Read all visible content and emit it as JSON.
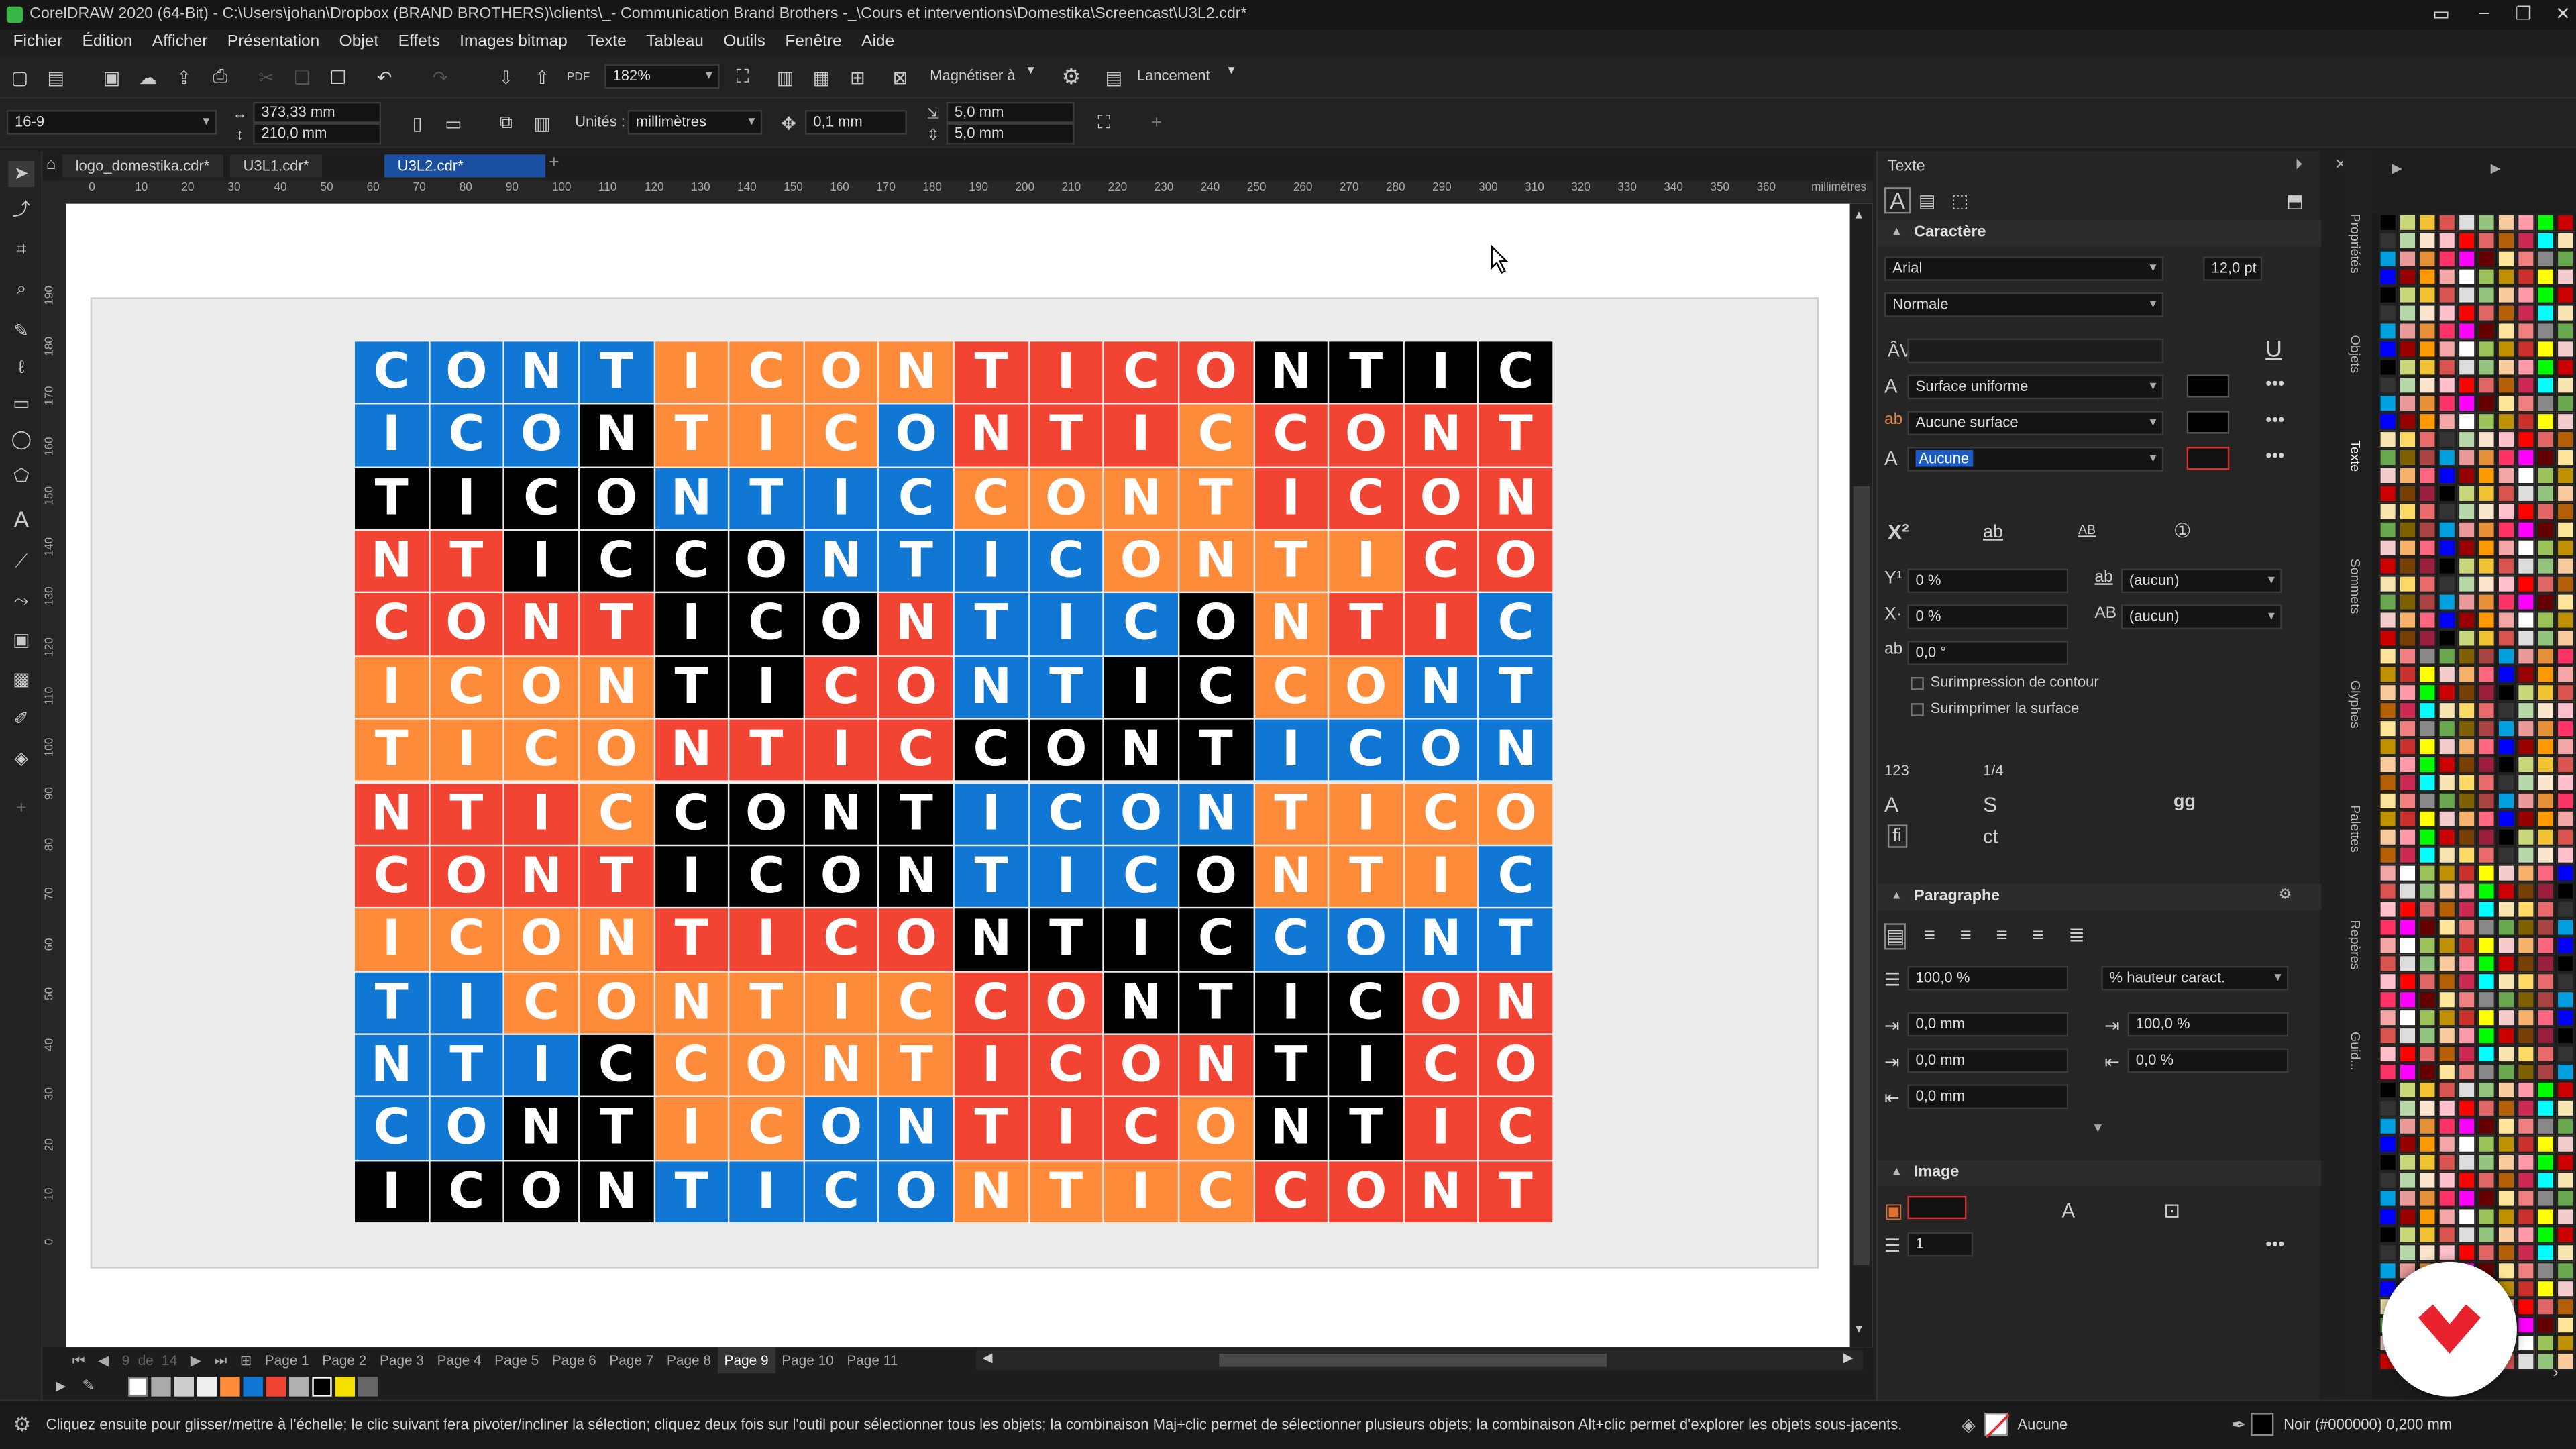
{
  "window": {
    "title": "CorelDRAW 2020 (64-Bit) - C:\\Users\\johan\\Dropbox (BRAND BROTHERS)\\clients\\_- Communication Brand Brothers -_\\Cours et interventions\\Domestika\\Screencast\\U3L2.cdr*"
  },
  "menu": [
    "Fichier",
    "Édition",
    "Afficher",
    "Présentation",
    "Objet",
    "Effets",
    "Images bitmap",
    "Texte",
    "Tableau",
    "Outils",
    "Fenêtre",
    "Aide"
  ],
  "toolbar1": {
    "zoom": "182%",
    "snap": "Magnétiser à",
    "launch": "Lancement"
  },
  "toolbar2": {
    "preset": "16-9",
    "width": "373,33 mm",
    "height": "210,0 mm",
    "units_label": "Unités :",
    "units": "millimètres",
    "nudge": "0,1 mm",
    "dup_x": "5,0 mm",
    "dup_y": "5,0 mm"
  },
  "doctabs": [
    "logo_domestika.cdr*",
    "U3L1.cdr*",
    "U3L2.cdr*"
  ],
  "ruler": {
    "unit": "millimètres",
    "ticks": [
      "0",
      "10",
      "20",
      "30",
      "40",
      "50",
      "60",
      "70",
      "80",
      "90",
      "100",
      "110",
      "120",
      "130",
      "140",
      "150",
      "160",
      "170",
      "180",
      "190",
      "200",
      "210",
      "220",
      "230",
      "240",
      "250",
      "260",
      "270",
      "280",
      "290",
      "300",
      "310",
      "320",
      "330",
      "340",
      "350",
      "360"
    ],
    "vticks": [
      "190",
      "180",
      "170",
      "160",
      "150",
      "140",
      "130",
      "120",
      "110",
      "100",
      "90",
      "80",
      "70",
      "60",
      "50",
      "40",
      "30",
      "20",
      "10",
      "0"
    ]
  },
  "pages": {
    "current": "9",
    "of": "de",
    "total": "14",
    "tabs": [
      "Page 1",
      "Page 2",
      "Page 3",
      "Page 4",
      "Page 5",
      "Page 6",
      "Page 7",
      "Page 8",
      "Page 9",
      "Page 10",
      "Page 11"
    ]
  },
  "artwork": {
    "colors": {
      "B": "#1077d4",
      "O": "#fd8b3a",
      "R": "#f24432",
      "K": "#000000"
    },
    "glyphs": [
      "C",
      "O",
      "N",
      "T",
      "I",
      "C",
      "O",
      "N",
      "T",
      "I",
      "C",
      "O",
      "N",
      "T",
      "I",
      "C"
    ],
    "rows": [
      "BBBBOOOORRRRKKKK",
      "BBBKOOOBRRRORRRR",
      "KKKKBBBBOOOORRRR",
      "RRKKKKBBBBOOOORR",
      "RRRRKKKRBBBKORRB",
      "OOOOKKRRBBKKOOBB",
      "OOOORRRRKKKKBBBB",
      "RRROKKKKBBBBOOOO",
      "RRRRKKKKBBBKOOOB",
      "OOOORRRRKKKKBBBB",
      "BBOOOOOORRKKKKRR",
      "BBBKOOOORRRRKKRR",
      "BBKKOOBBRRROKKRR",
      "KKKKBBBBOOOORRRR"
    ]
  },
  "docker": {
    "title": "Texte",
    "character": "Caractère",
    "font": "Arial",
    "size": "12,0 pt",
    "style": "Normale",
    "fill": "Surface uniforme",
    "bg_fill": "Aucune surface",
    "outline": "Aucune",
    "baseline": "0 %",
    "x_shift": "0 %",
    "rotation": "0,0 °",
    "ab_none": "(aucun)",
    "overprint_outline": "Surimpression de contour",
    "overprint_fill": "Surimprimer la surface",
    "numbers": "123",
    "fraction": "1/4",
    "gg": "gg",
    "paragraph": "Paragraphe",
    "line_spacing": "100,0 %",
    "spacing_unit": "% hauteur caract.",
    "indent1": "0,0 mm",
    "indent2": "0,0 mm",
    "indent3": "0,0 mm",
    "char_spacing": "100,0 %",
    "word_spacing": "0,0 %",
    "image": "Image",
    "image_count": "1"
  },
  "vertical_tabs": [
    "Propriétés",
    "Objets",
    "Texte",
    "Sommets",
    "Glyphes",
    "Palettes",
    "Repères",
    "Guid..."
  ],
  "status": {
    "hint": "Cliquez ensuite pour glisser/mettre à l'échelle; le clic suivant fera pivoter/incliner la sélection; cliquez deux fois sur l'outil pour sélectionner tous les objets; la combinaison Maj+clic permet de sélectionner plusieurs objets; la combinaison Alt+clic permet d'explorer les objets sous-jacents.",
    "fill": "Aucune",
    "outline": "Noir (#000000)  0,200 mm"
  }
}
